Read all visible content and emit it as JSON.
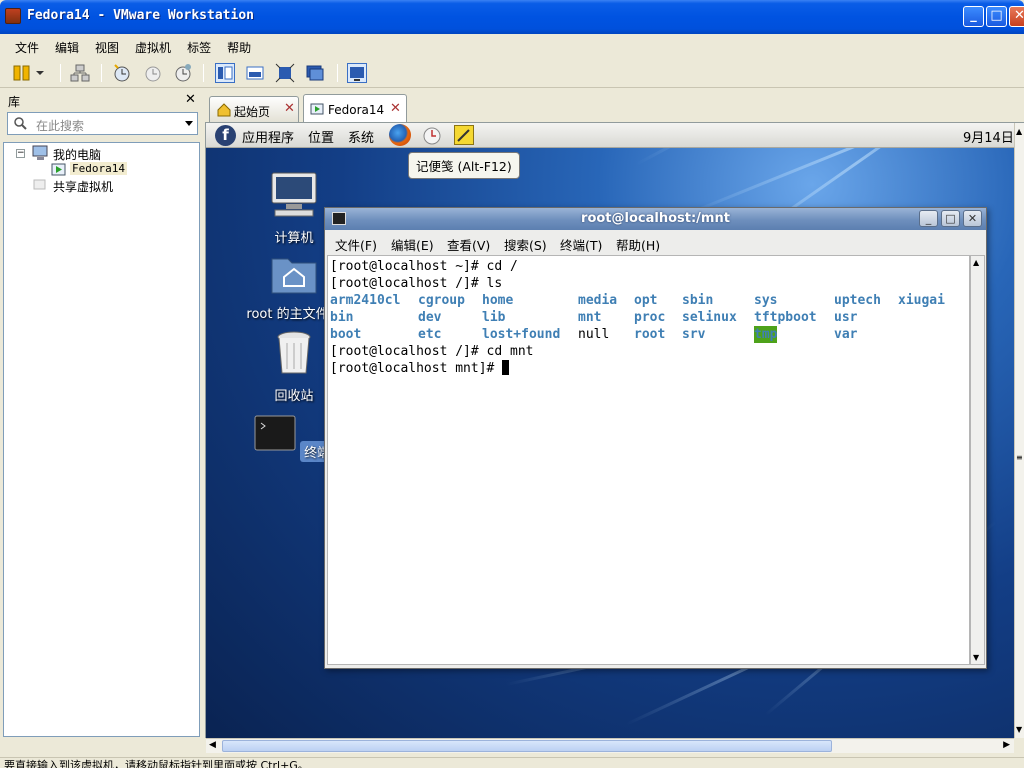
{
  "window": {
    "title": "Fedora14 - VMware Workstation"
  },
  "menu": [
    "文件",
    "编辑",
    "视图",
    "虚拟机",
    "标签",
    "帮助"
  ],
  "library": {
    "title": "库",
    "search_placeholder": "在此搜索",
    "tree": {
      "my_computer": "我的电脑",
      "vm": "Fedora14",
      "shared": "共享虚拟机"
    }
  },
  "tabs": [
    {
      "label": "起始页"
    },
    {
      "label": "Fedora14"
    }
  ],
  "guest": {
    "panel": {
      "apps": "应用程序",
      "places": "位置",
      "system": "系统",
      "clock": "9月14日"
    },
    "tooltip": "记便笺 (Alt-F12)",
    "desktop_icons": [
      {
        "label": "计算机",
        "icon": "computer-icon"
      },
      {
        "label": "root 的主文件夹",
        "icon": "home-folder-icon"
      },
      {
        "label": "回收站",
        "icon": "trash-icon"
      },
      {
        "label": "终端",
        "icon": "terminal-icon"
      }
    ],
    "terminal": {
      "title": "root@localhost:/mnt",
      "menu": [
        "文件(F)",
        "编辑(E)",
        "查看(V)",
        "搜索(S)",
        "终端(T)",
        "帮助(H)"
      ],
      "lines": [
        "[root@localhost ~]# cd /",
        "[root@localhost /]# ls",
        "[root@localhost /]# cd mnt",
        "[root@localhost mnt]# "
      ],
      "ls_columns": [
        [
          "arm2410cl",
          "bin",
          "boot"
        ],
        [
          "cgroup",
          "dev",
          "etc"
        ],
        [
          "home",
          "lib",
          "lost+found"
        ],
        [
          "media",
          "mnt",
          "null"
        ],
        [
          "opt",
          "proc",
          "root"
        ],
        [
          "sbin",
          "selinux",
          "srv"
        ],
        [
          "sys",
          "tftpboot",
          "tmp"
        ],
        [
          "uptech",
          "usr",
          "var"
        ],
        [
          "xiugai"
        ]
      ]
    }
  },
  "status_bar": "要直接输入到该虚拟机，请移动鼠标指针到里面或按 Ctrl+G。",
  "colors": {
    "accent": "#0053E1",
    "dir": "#3f7fb4",
    "tmp_bg": "#4ea21a"
  }
}
